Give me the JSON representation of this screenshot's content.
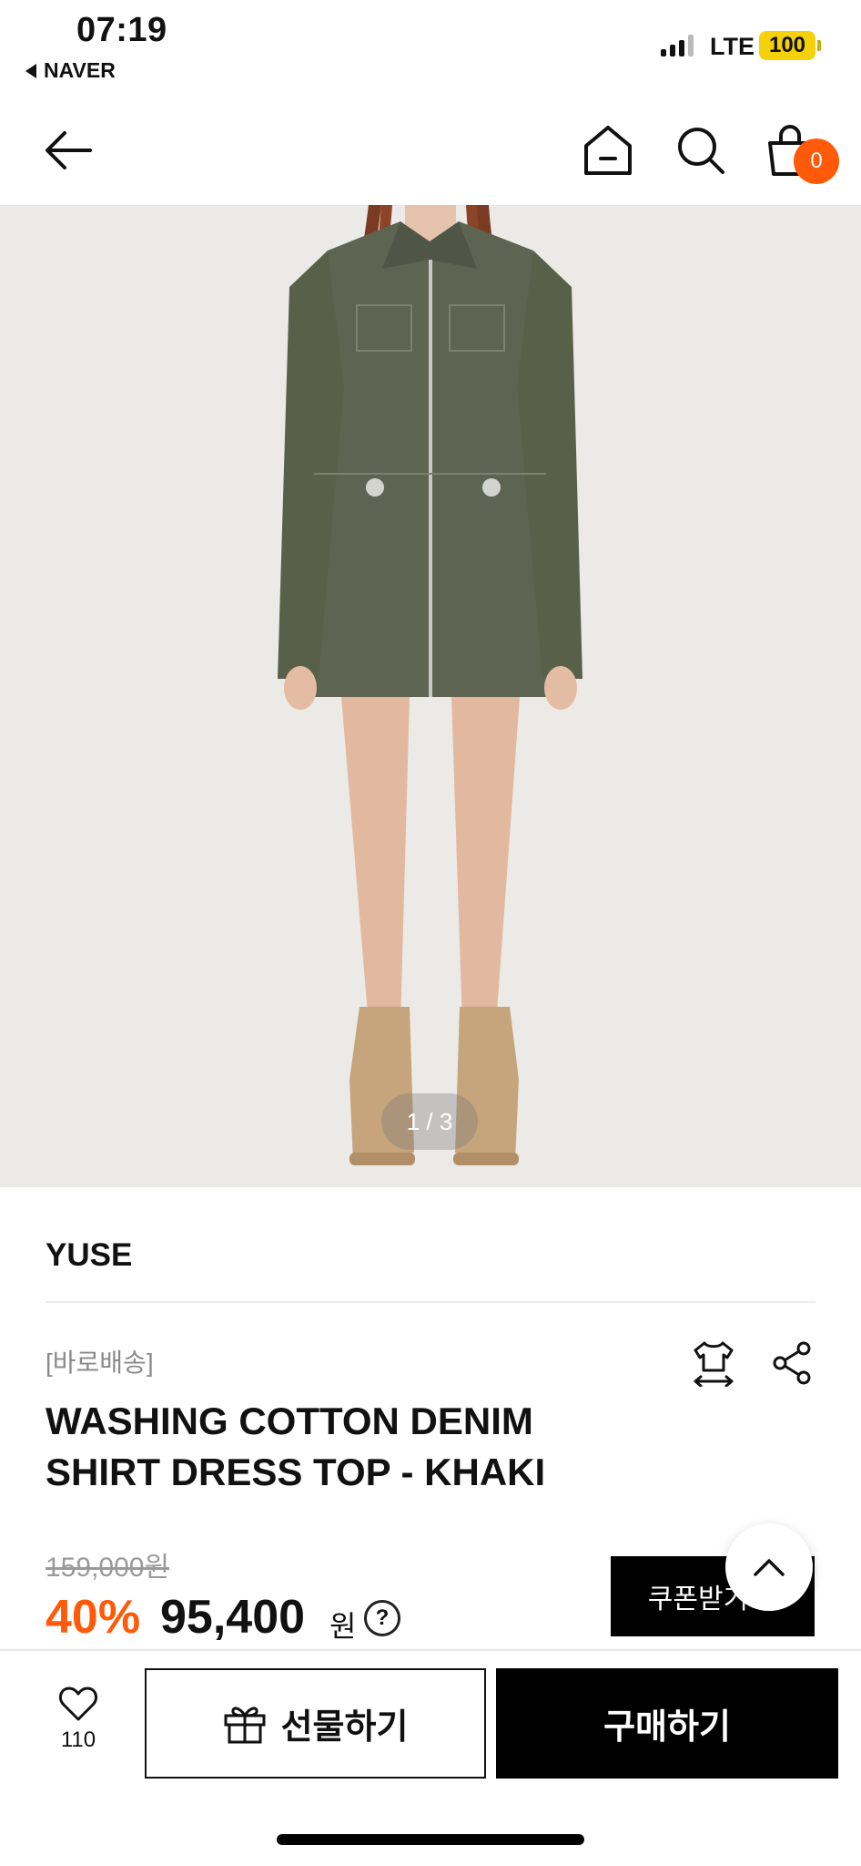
{
  "status_bar": {
    "time": "07:19",
    "back_app": "NAVER",
    "network": "LTE",
    "battery": "100"
  },
  "nav": {
    "cart_count": "0",
    "icons": [
      "back-arrow-icon",
      "home-icon",
      "search-icon",
      "shopping-bag-icon"
    ]
  },
  "image": {
    "counter": "1 / 3",
    "current": 1,
    "total": 3
  },
  "product": {
    "brand": "YUSE",
    "tag": "[바로배송]",
    "title_line1": "WASHING COTTON DENIM",
    "title_line2": "SHIRT DRESS TOP - KHAKI",
    "original_price": "159,000원",
    "discount": "40%",
    "price": "95,400",
    "currency": "원",
    "help": "?"
  },
  "coupon": {
    "label": "쿠폰받기"
  },
  "bottom": {
    "like_count": "110",
    "gift_label": "선물하기",
    "buy_label": "구매하기"
  },
  "colors": {
    "accent": "#ff5a0a",
    "battery": "#f5d10c",
    "black": "#000000"
  }
}
